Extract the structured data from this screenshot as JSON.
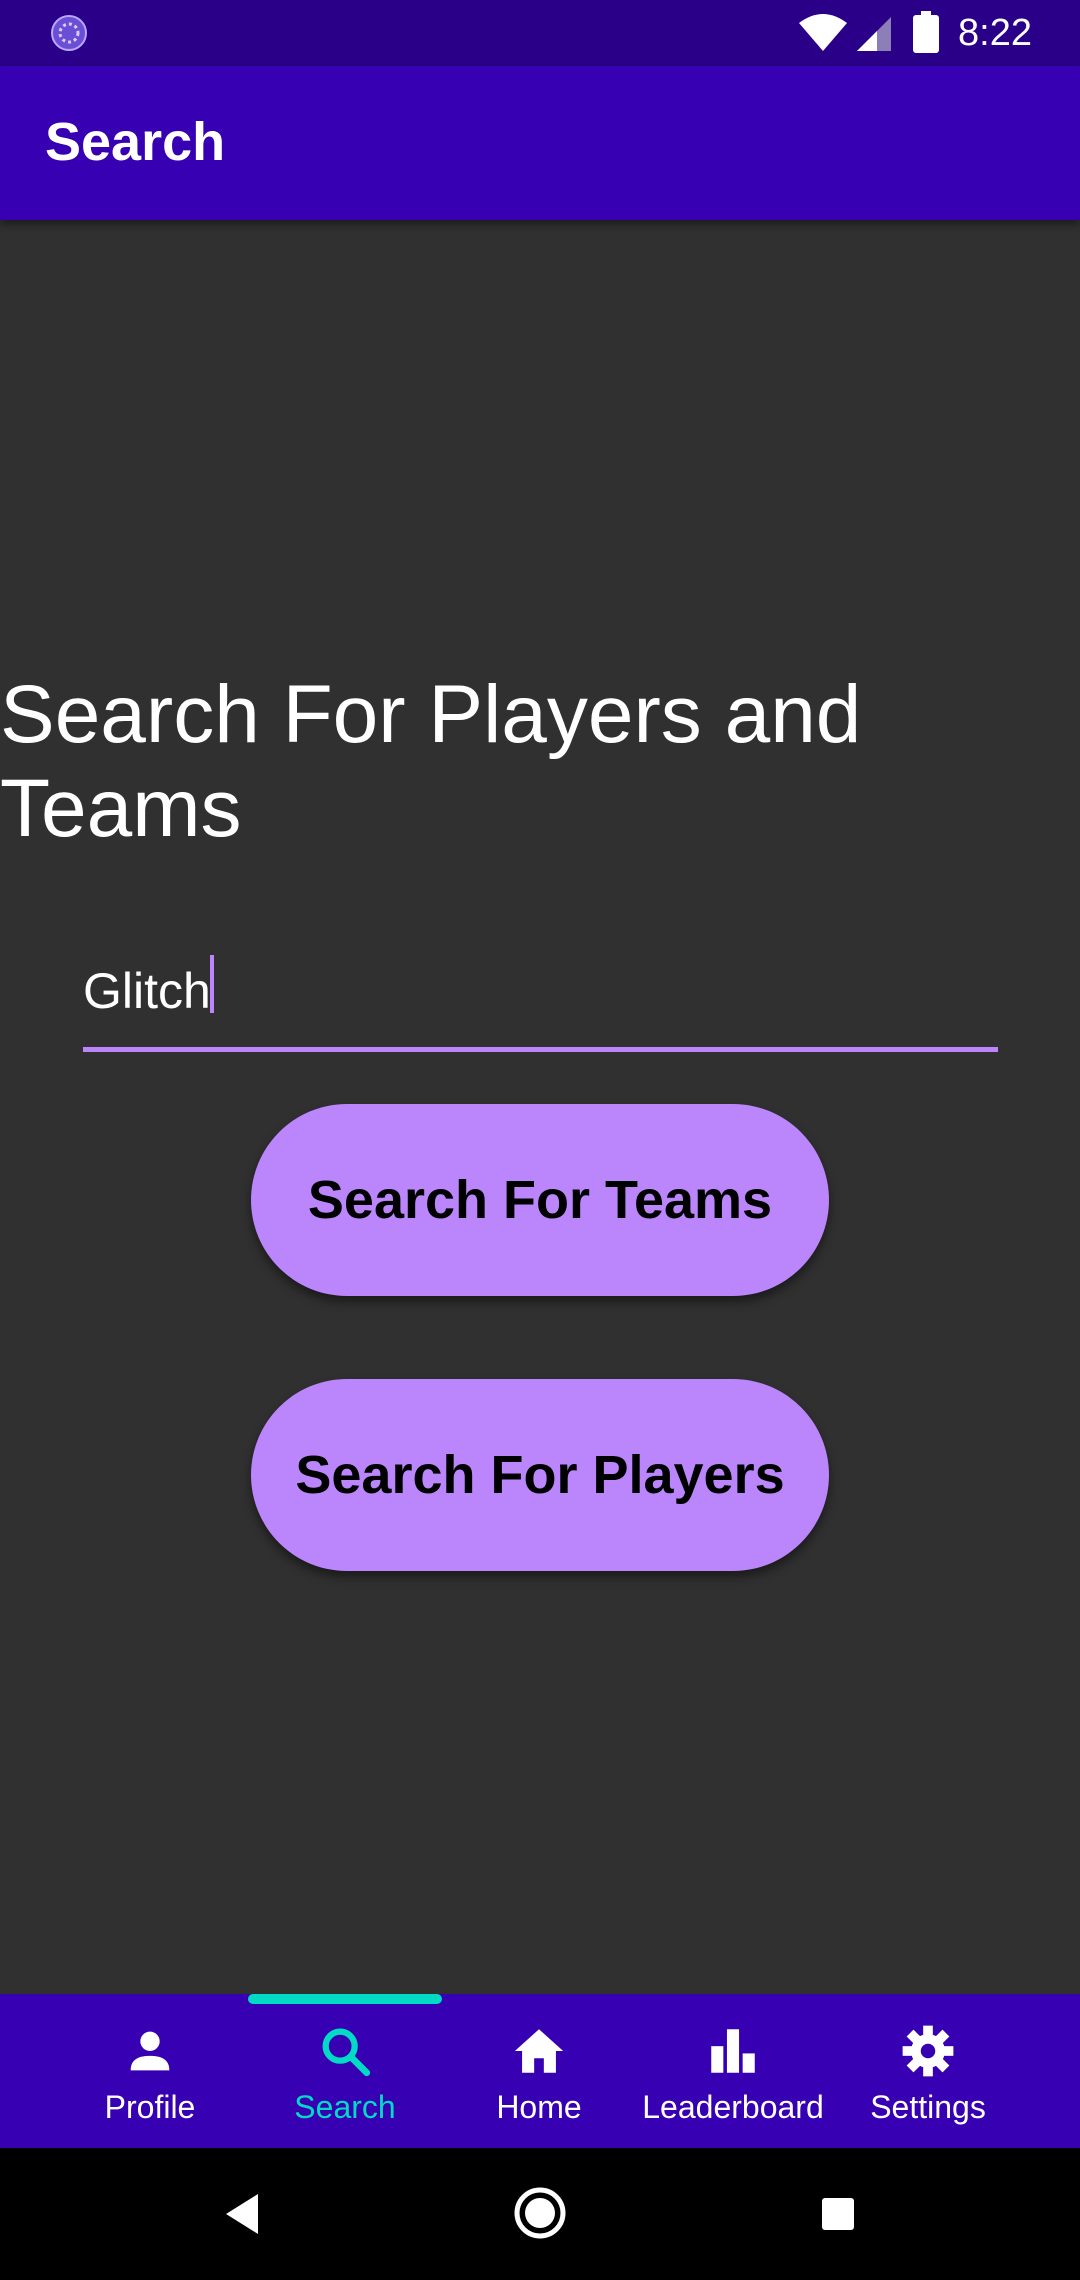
{
  "status_bar": {
    "time": "8:22"
  },
  "app_bar": {
    "title": "Search"
  },
  "main": {
    "heading": "Search For Players and Teams",
    "search_input": {
      "value": "Glitch",
      "placeholder": ""
    },
    "buttons": {
      "teams": "Search For Teams",
      "players": "Search For Players"
    }
  },
  "bottom_nav": {
    "items": [
      {
        "label": "Profile",
        "icon": "person-icon"
      },
      {
        "label": "Search",
        "icon": "search-icon",
        "active": true
      },
      {
        "label": "Home",
        "icon": "home-icon"
      },
      {
        "label": "Leaderboard",
        "icon": "bar-chart-icon"
      },
      {
        "label": "Settings",
        "icon": "gear-icon"
      }
    ]
  },
  "colors": {
    "primary": "#3700b3",
    "status_bar": "#2a0089",
    "accent": "#bb86fc",
    "active_tab": "#03dac5",
    "background": "#303030"
  }
}
